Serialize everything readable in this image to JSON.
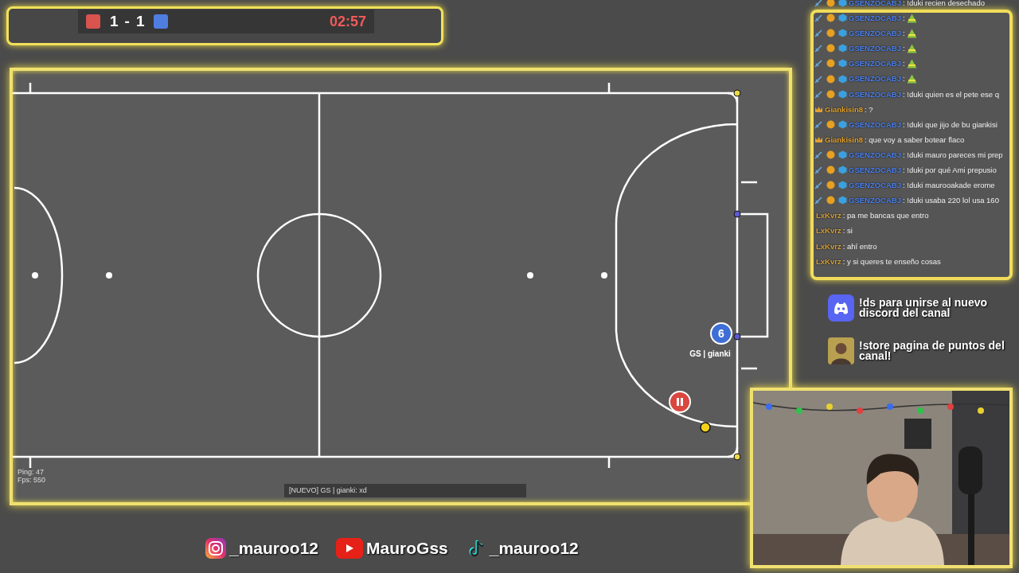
{
  "scoreboard": {
    "teams": [
      {
        "color": "#d9534f",
        "score": "1"
      },
      {
        "color": "#4f7de0",
        "score": "1"
      }
    ],
    "separator": "-",
    "clock": "02:57"
  },
  "pitch": {
    "players": [
      {
        "kind": "number",
        "color": "#3e6fd6",
        "number": "6",
        "name": "GS | gianki"
      },
      {
        "kind": "paused",
        "color": "#d9473f"
      }
    ]
  },
  "hud": {
    "ping": "Ping: 47",
    "fps": "Fps: 550"
  },
  "chat_input": {
    "value": "[NUEVO] GS | gianki: xd"
  },
  "chat": {
    "messages": [
      {
        "user": "GSENZOCABJ",
        "color": "#4a80f0",
        "kind": "subscriber",
        "text": ": !duki recien desechado",
        "emote": false
      },
      {
        "user": "GSENZOCABJ",
        "color": "#4a80f0",
        "kind": "subscriber",
        "text": ":",
        "emote": true
      },
      {
        "user": "GSENZOCABJ",
        "color": "#4a80f0",
        "kind": "subscriber",
        "text": ":",
        "emote": true
      },
      {
        "user": "GSENZOCABJ",
        "color": "#4a80f0",
        "kind": "subscriber",
        "text": ":",
        "emote": true
      },
      {
        "user": "GSENZOCABJ",
        "color": "#4a80f0",
        "kind": "subscriber",
        "text": ":",
        "emote": true
      },
      {
        "user": "GSENZOCABJ",
        "color": "#4a80f0",
        "kind": "subscriber",
        "text": ":",
        "emote": true
      },
      {
        "user": "GSENZOCABJ",
        "color": "#4a80f0",
        "kind": "subscriber",
        "text": ": !duki quien es el pete ese q",
        "emote": false
      },
      {
        "user": "Giankisin8",
        "color": "#e0a030",
        "kind": "vip",
        "text": ": ?",
        "emote": false
      },
      {
        "user": "GSENZOCABJ",
        "color": "#4a80f0",
        "kind": "subscriber",
        "text": ": !duki que jijo de bu giankisi",
        "emote": false
      },
      {
        "user": "Giankisin8",
        "color": "#e0a030",
        "kind": "vip",
        "text": ": que voy a saber botear flaco",
        "emote": false
      },
      {
        "user": "GSENZOCABJ",
        "color": "#4a80f0",
        "kind": "subscriber",
        "text": ": !duki mauro pareces mi prep",
        "emote": false
      },
      {
        "user": "GSENZOCABJ",
        "color": "#4a80f0",
        "kind": "subscriber",
        "text": ": !duki por qué Ami prepusio",
        "emote": false
      },
      {
        "user": "GSENZOCABJ",
        "color": "#4a80f0",
        "kind": "subscriber",
        "text": ": !duki maurooakade erome",
        "emote": false
      },
      {
        "user": "GSENZOCABJ",
        "color": "#4a80f0",
        "kind": "subscriber",
        "text": ": !duki usaba 220 lol usa 160",
        "emote": false
      },
      {
        "user": "LxKvrz",
        "color": "#d4a03a",
        "kind": "viewer",
        "text": ": pa me bancas que entro",
        "emote": false
      },
      {
        "user": "LxKvrz",
        "color": "#d4a03a",
        "kind": "viewer",
        "text": ": si",
        "emote": false
      },
      {
        "user": "LxKvrz",
        "color": "#d4a03a",
        "kind": "viewer",
        "text": ": ahí entro",
        "emote": false
      },
      {
        "user": "LxKvrz",
        "color": "#d4a03a",
        "kind": "viewer",
        "text": ": y si queres te enseño cosas",
        "emote": false
      }
    ]
  },
  "promos": [
    {
      "kind": "discord",
      "text": "!ds para unirse al nuevo discord del canal"
    },
    {
      "kind": "store",
      "text": "!store pagina de puntos del canal!"
    }
  ],
  "socials": [
    {
      "kind": "instagram",
      "handle": "_mauroo12"
    },
    {
      "kind": "youtube",
      "handle": "MauroGss"
    },
    {
      "kind": "tiktok",
      "handle": "_mauroo12"
    }
  ]
}
